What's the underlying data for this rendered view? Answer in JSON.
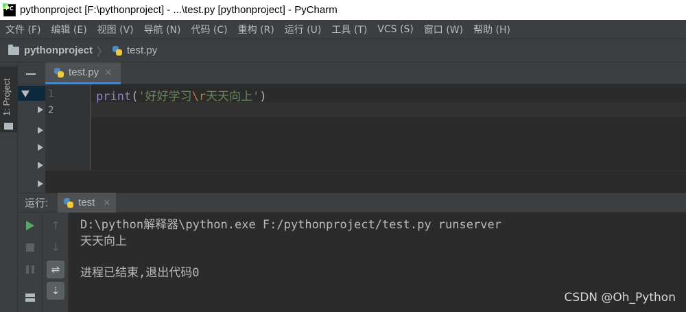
{
  "window": {
    "title": "pythonproject [F:\\pythonproject] - ...\\test.py [pythonproject] - PyCharm",
    "logo_text": "PC"
  },
  "menu": {
    "items": [
      {
        "label": "文件 (F)"
      },
      {
        "label": "编辑 (E)"
      },
      {
        "label": "视图 (V)"
      },
      {
        "label": "导航 (N)"
      },
      {
        "label": "代码 (C)"
      },
      {
        "label": "重构 (R)"
      },
      {
        "label": "运行 (U)"
      },
      {
        "label": "工具 (T)"
      },
      {
        "label": "VCS (S)"
      },
      {
        "label": "窗口 (W)"
      },
      {
        "label": "帮助 (H)"
      }
    ]
  },
  "navbar": {
    "project": "pythonproject",
    "separator": "〉",
    "file": "test.py"
  },
  "sidebar": {
    "project_tab_label": "1: Project"
  },
  "editor": {
    "tab": {
      "label": "test.py",
      "close": "✕"
    },
    "line_numbers": [
      "1",
      "2"
    ],
    "code": {
      "func": "print",
      "open": "(",
      "str_start": "'好好学习",
      "escape": "\\r",
      "str_end": "天天向上'",
      "close": ")"
    }
  },
  "run": {
    "title": "运行:",
    "tab_label": "test",
    "tab_close": "✕",
    "up_arrow": "↑",
    "down_arrow": "↓",
    "wrap_glyph": "⇌",
    "scroll_glyph": "⇣",
    "console_lines": [
      "D:\\python解释器\\python.exe F:/pythonproject/test.py runserver",
      "天天向上",
      "进程已结束,退出代码0"
    ]
  },
  "watermark": "CSDN @Oh_Python",
  "colors": {
    "accent_tab": "#4a88c7",
    "run_green": "#59a869",
    "string": "#6a8759",
    "keyword_builtin": "#8888c6",
    "escape": "#cc7832"
  }
}
